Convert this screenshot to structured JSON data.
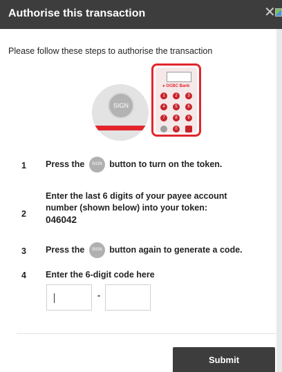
{
  "dialog": {
    "title": "Authorise this transaction",
    "intro": "Please follow these steps to authorise the transaction"
  },
  "illustration": {
    "sign_label": "SIGN",
    "token_brand": "OCBC Bank",
    "keys": [
      "1",
      "2",
      "3",
      "4",
      "5",
      "6",
      "7",
      "8",
      "9",
      "0"
    ]
  },
  "steps": [
    {
      "num": "1",
      "before": "Press the",
      "pill": "SIGN",
      "after": "button to turn on the token."
    },
    {
      "num": "2",
      "line1": "Enter the last 6 digits of your payee account",
      "line2": "number (shown below) into your token:",
      "code": "046042"
    },
    {
      "num": "3",
      "before": "Press the",
      "pill": "SIGN",
      "after": "button again to generate a code."
    },
    {
      "num": "4",
      "text": "Enter the 6-digit code here"
    }
  ],
  "code_input": {
    "first": "",
    "second": "",
    "separator": "-"
  },
  "submit_label": "Submit",
  "colors": {
    "header": "#3d3d3d",
    "accent": "#e2252b"
  },
  "icons": {
    "close": "close-icon",
    "image": "broken-image-icon"
  }
}
